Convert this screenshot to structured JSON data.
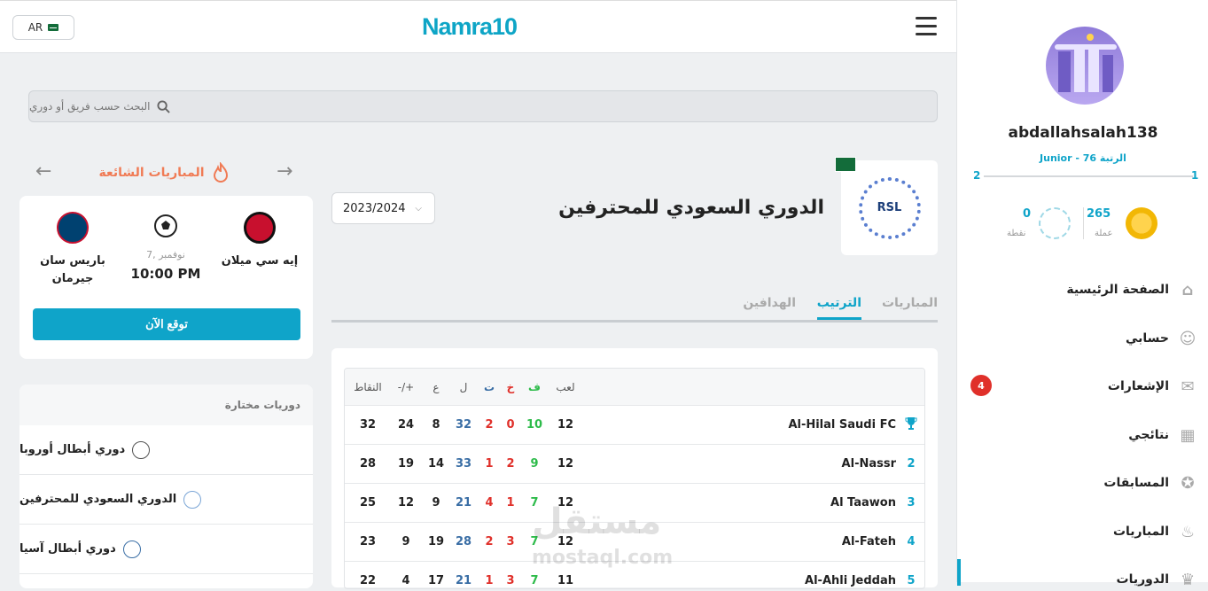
{
  "header": {
    "lang": "AR",
    "logo": "Namra10"
  },
  "search": {
    "placeholder": "البحث حسب فريق أو دوري"
  },
  "trending": {
    "title": "المباريات الشائعة",
    "match": {
      "home": "إيه سي ميلان",
      "away_line1": "باريس سان",
      "away_line2": "جيرمان",
      "date": "7, نوفمبر",
      "time": "10:00 PM",
      "cta": "توقع الآن"
    }
  },
  "featured": {
    "title": "دوريات مختارة",
    "items": [
      {
        "label": "دوري أبطال أوروبا",
        "icon": "champions-league-icon"
      },
      {
        "label": "الدوري السعودي للمحترفين",
        "icon": "saudi-league-icon"
      },
      {
        "label": "دوري أبطال آسيا",
        "icon": "afc-icon"
      }
    ]
  },
  "league": {
    "name": "الدوري السعودي للمحترفين",
    "logo_text": "RSL",
    "season": "2023/2024"
  },
  "tabs": [
    {
      "label": "المباريات",
      "active": false
    },
    {
      "label": "الترتيب",
      "active": true
    },
    {
      "label": "الهدافين",
      "active": false
    }
  ],
  "table": {
    "headers": {
      "played": "لعب",
      "won": "ف",
      "drawn": "خ",
      "lost": "ت",
      "gf": "ل",
      "ga": "ع",
      "gd": "-/+",
      "points": "النقاط"
    },
    "rows": [
      {
        "pos": "",
        "team": "Al-Hilal Saudi FC",
        "played": "12",
        "won": "10",
        "drawn": "0",
        "lost": "2",
        "gf": "32",
        "ga": "8",
        "gd": "24",
        "points": "32"
      },
      {
        "pos": "2",
        "team": "Al-Nassr",
        "played": "12",
        "won": "9",
        "drawn": "2",
        "lost": "1",
        "gf": "33",
        "ga": "14",
        "gd": "19",
        "points": "28"
      },
      {
        "pos": "3",
        "team": "Al Taawon",
        "played": "12",
        "won": "7",
        "drawn": "1",
        "lost": "4",
        "gf": "21",
        "ga": "9",
        "gd": "12",
        "points": "25"
      },
      {
        "pos": "4",
        "team": "Al-Fateh",
        "played": "12",
        "won": "7",
        "drawn": "3",
        "lost": "2",
        "gf": "28",
        "ga": "19",
        "gd": "9",
        "points": "23"
      },
      {
        "pos": "5",
        "team": "Al-Ahli Jeddah",
        "played": "11",
        "won": "7",
        "drawn": "3",
        "lost": "1",
        "gf": "21",
        "ga": "17",
        "gd": "4",
        "points": "22"
      }
    ]
  },
  "profile": {
    "username": "abdallahsalah138",
    "rank": "Junior - الرتبة 76",
    "level_from": "1",
    "level_to": "2",
    "coins_value": "265",
    "coins_label": "عملة",
    "points_value": "0",
    "points_label": "نقطة"
  },
  "nav": [
    {
      "label": "الصفحة الرئيسية",
      "icon": "home-icon"
    },
    {
      "label": "حسابي",
      "icon": "user-icon"
    },
    {
      "label": "الإشعارات",
      "icon": "chat-icon",
      "badge": "4"
    },
    {
      "label": "نتائجي",
      "icon": "calendar-icon"
    },
    {
      "label": "المسابقات",
      "icon": "medal-icon"
    },
    {
      "label": "المباريات",
      "icon": "fire-icon"
    },
    {
      "label": "الدوريات",
      "icon": "trophy-icon"
    }
  ],
  "watermark": {
    "arabic": "مستقل",
    "latin": "mostaql.com"
  },
  "colors": {
    "accent": "#0fa4c9",
    "trend": "#f07b55",
    "won": "#2dbb4a",
    "lost": "#e0302a",
    "gf": "#3a6ea5"
  }
}
